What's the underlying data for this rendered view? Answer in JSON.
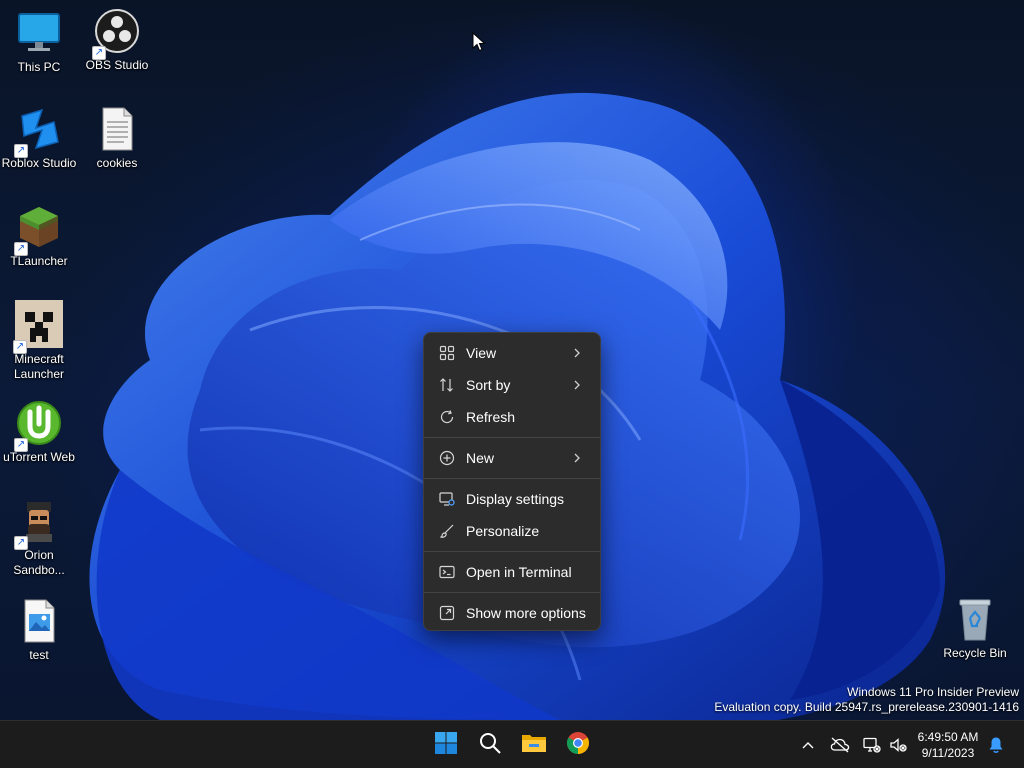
{
  "desktop": {
    "icons": [
      {
        "label": "This PC",
        "icon": "monitor-icon"
      },
      {
        "label": "OBS Studio",
        "icon": "obs-icon"
      },
      {
        "label": "Roblox Studio",
        "icon": "roblox-studio-icon"
      },
      {
        "label": "cookies",
        "icon": "text-file-icon"
      },
      {
        "label": "TLauncher",
        "icon": "grass-block-icon"
      },
      {
        "label": "Minecraft Launcher",
        "icon": "creeper-icon"
      },
      {
        "label": "uTorrent Web",
        "icon": "utorrent-icon"
      },
      {
        "label": "Orion Sandbo...",
        "icon": "orion-avatar-icon"
      },
      {
        "label": "test",
        "icon": "image-file-icon"
      },
      {
        "label": "Recycle Bin",
        "icon": "recycle-bin-icon"
      }
    ]
  },
  "context_menu": {
    "items": [
      {
        "label": "View",
        "icon": "grid-icon",
        "submenu": true
      },
      {
        "label": "Sort by",
        "icon": "sort-icon",
        "submenu": true
      },
      {
        "label": "Refresh",
        "icon": "refresh-icon",
        "submenu": false
      },
      {
        "label": "New",
        "icon": "plus-circle-icon",
        "submenu": true
      },
      {
        "label": "Display settings",
        "icon": "display-settings-icon",
        "submenu": false
      },
      {
        "label": "Personalize",
        "icon": "brush-icon",
        "submenu": false
      },
      {
        "label": "Open in Terminal",
        "icon": "terminal-icon",
        "submenu": false
      },
      {
        "label": "Show more options",
        "icon": "more-options-icon",
        "submenu": false
      }
    ]
  },
  "watermark": {
    "line1": "Windows 11 Pro Insider Preview",
    "line2": "Evaluation copy. Build 25947.rs_prerelease.230901-1416"
  },
  "taskbar": {
    "apps": [
      "start-icon",
      "search-icon",
      "file-explorer-icon",
      "chrome-icon"
    ],
    "tray": [
      "chevron-up-icon",
      "cloud-offline-icon",
      "network-icon",
      "volume-muted-icon"
    ],
    "time": "6:49:50 AM",
    "date": "9/11/2023",
    "accent": "#0078d4"
  }
}
